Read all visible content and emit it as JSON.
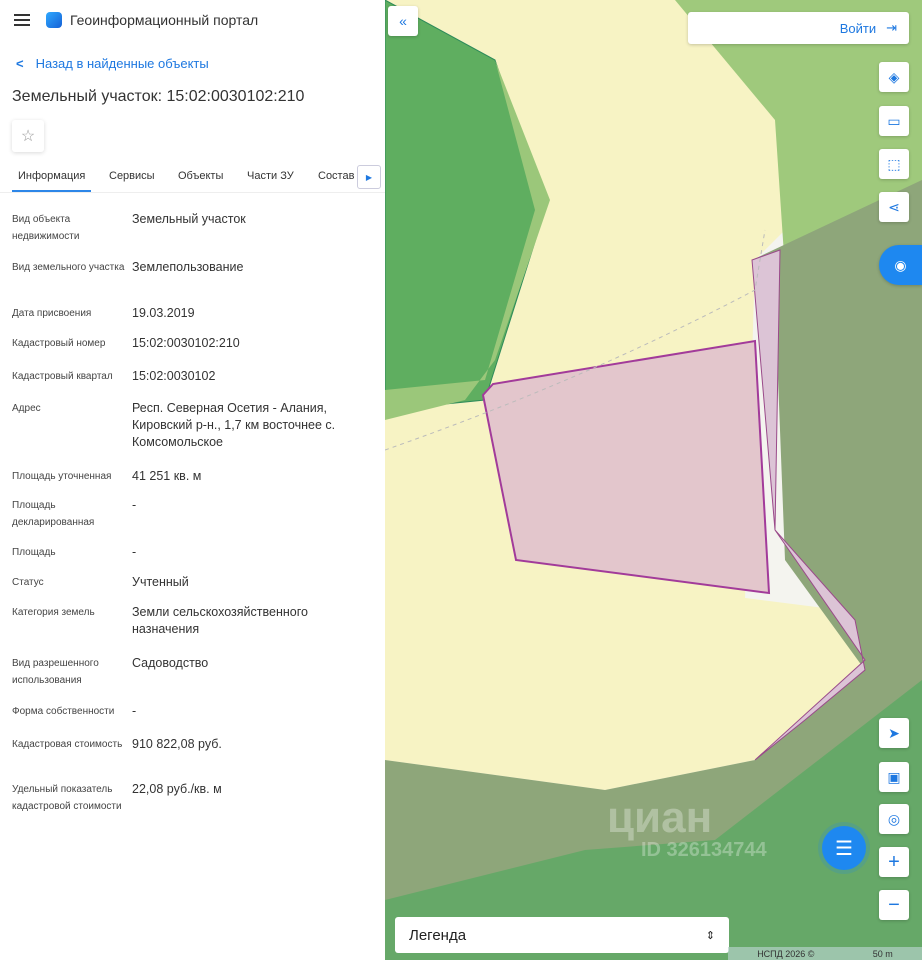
{
  "header": {
    "title": "Геоинформационный портал"
  },
  "back_link": "Назад в найденные объекты",
  "object_title": "Земельный участок: 15:02:0030102:210",
  "tabs": [
    "Информация",
    "Сервисы",
    "Объекты",
    "Части ЗУ",
    "Состав"
  ],
  "fields": [
    {
      "label": "Вид объекта недвижимости",
      "value": "Земельный участок"
    },
    {
      "label": "Вид земельного участка",
      "value": "Землепользование"
    },
    {
      "label": "Дата присвоения",
      "value": "19.03.2019"
    },
    {
      "label": "Кадастровый номер",
      "value": "15:02:0030102:210"
    },
    {
      "label": "Кадастровый квартал",
      "value": "15:02:0030102"
    },
    {
      "label": "Адрес",
      "value": "Респ. Северная Осетия - Алания, Кировский р-н., 1,7 км восточнее с. Комсомольское"
    },
    {
      "label": "Площадь уточненная",
      "value": "41 251 кв. м"
    },
    {
      "label": "Площадь декларированная",
      "value": "-"
    },
    {
      "label": "Площадь",
      "value": "-"
    },
    {
      "label": "Статус",
      "value": "Учтенный"
    },
    {
      "label": "Категория земель",
      "value": "Земли сельскохозяйственного назначения"
    },
    {
      "label": "Вид разрешенного использования",
      "value": "Садоводство"
    },
    {
      "label": "Форма собственности",
      "value": "-"
    },
    {
      "label": "Кадастровая стоимость",
      "value": "910 822,08 руб."
    },
    {
      "label": "Удельный показатель кадастровой стоимости",
      "value": "22,08 руб./кв. м"
    }
  ],
  "map": {
    "login": "Войти",
    "legend": "Легенда",
    "attribution": "НСПД 2026 ©",
    "scale": "50 m",
    "watermark": "циан",
    "watermark_id": "ID 326134744"
  },
  "colors": {
    "accent": "#1e78e0",
    "parcel": "#e3c6cc",
    "parcel_border": "#a23b9a"
  }
}
